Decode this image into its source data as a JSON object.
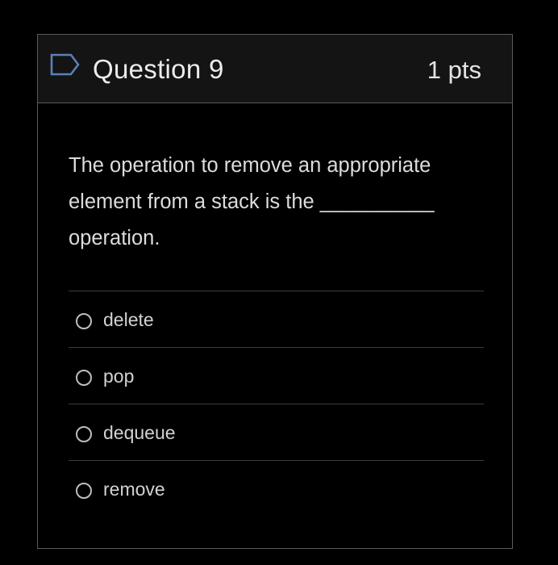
{
  "question": {
    "title": "Question 9",
    "points": "1 pts",
    "text": "The operation to remove an appropriate element from a stack is the __________ operation."
  },
  "answers": [
    {
      "label": "delete",
      "selected": false
    },
    {
      "label": "pop",
      "selected": false
    },
    {
      "label": "dequeue",
      "selected": false
    },
    {
      "label": "remove",
      "selected": false
    }
  ],
  "icons": {
    "bookmark": "bookmark-flag-icon",
    "radio": "radio-button-icon"
  },
  "colors": {
    "background": "#000000",
    "header_background": "#141414",
    "border": "#5a5a5a",
    "bookmark_outline": "#5b7fb8",
    "text": "#dcdcdc"
  }
}
